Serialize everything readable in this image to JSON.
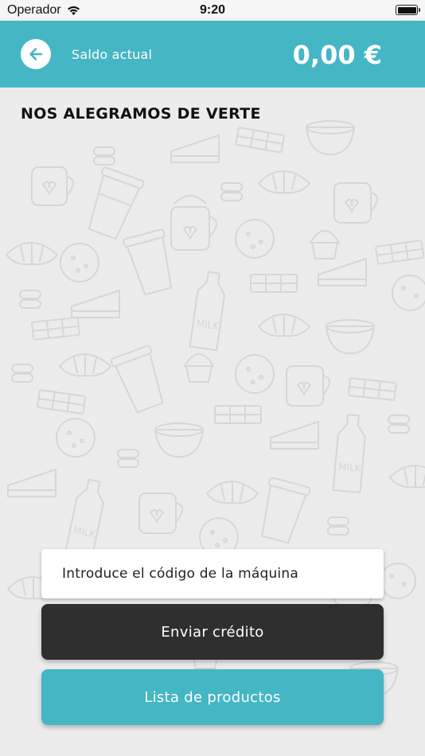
{
  "status_bar": {
    "carrier": "Operador",
    "time": "9:20",
    "icons": [
      "wifi-icon",
      "battery-icon"
    ]
  },
  "header": {
    "back_icon": "arrow-left-icon",
    "balance_label": "Saldo actual",
    "balance_value": "0,00 €"
  },
  "main": {
    "greeting": "NOS ALEGRAMOS DE VERTE",
    "code_input_placeholder": "Introduce el código de la máquina",
    "send_credit_label": "Enviar crédito",
    "product_list_label": "Lista de productos"
  },
  "colors": {
    "accent": "#45b6c4",
    "dark_button": "#2f2f2f",
    "background": "#ececec"
  }
}
